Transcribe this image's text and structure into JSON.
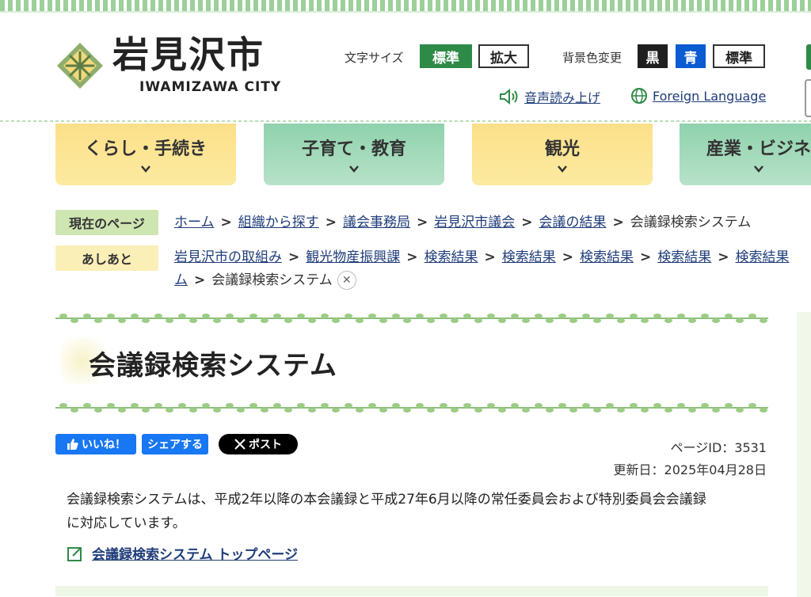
{
  "header": {
    "logo_title": "岩見沢市",
    "logo_sub": "IWAMIZAWA CITY",
    "font_size_label": "文字サイズ",
    "font_size_standard": "標準",
    "font_size_large": "拡大",
    "bg_label": "背景色変更",
    "bg_black": "黒",
    "bg_blue": "青",
    "bg_standard": "標準",
    "tts_link": "音声読み上げ",
    "lang_link": "Foreign Language"
  },
  "nav": {
    "items": [
      {
        "label": "くらし・手続き"
      },
      {
        "label": "子育て・教育"
      },
      {
        "label": "観光"
      },
      {
        "label": "産業・ビジネ"
      }
    ]
  },
  "breadcrumb": {
    "current_label": "現在のページ",
    "current": [
      "ホーム",
      "組織から探す",
      "議会事務局",
      "岩見沢市議会",
      "会議の結果"
    ],
    "current_last": "会議録検索システム",
    "trail_label": "あしあと",
    "trail": [
      "岩見沢市の取組み",
      "観光物産振興課",
      "検索結果",
      "検索結果",
      "検索結果",
      "検索結果",
      "検索結果"
    ],
    "trail_wrap": "ム",
    "trail_last": "会議録検索システム"
  },
  "page": {
    "title": "会議録検索システム",
    "share_like": "いいね！",
    "share_fb": "シェアする",
    "share_x": "ポスト",
    "page_id": "ページID：3531",
    "updated": "更新日：2025年04月28日",
    "body_line1": "会議録検索システムは、平成2年以降の本会議録と平成27年6月以降の常任委員会および特別委員会会議録",
    "body_line2": "に対応しています。",
    "top_link": "会議録検索システム トップページ"
  },
  "colors": {
    "accent_green": "#2e8a47",
    "link_blue": "#1f3d7a"
  }
}
